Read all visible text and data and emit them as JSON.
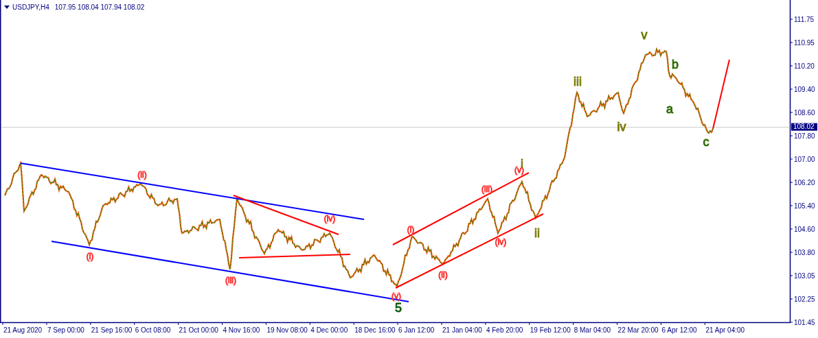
{
  "header": {
    "symbol": "USDJPY,H4",
    "quote": "107.95 108.04 107.94 108.02"
  },
  "price_axis": {
    "labels": [
      "111.75",
      "110.95",
      "110.20",
      "109.40",
      "108.60",
      "107.80",
      "107.00",
      "106.20",
      "105.40",
      "104.60",
      "103.80",
      "103.05",
      "102.25",
      "101.45"
    ],
    "current_price": "108.02"
  },
  "time_axis": {
    "labels": [
      "21 Aug 2020",
      "7 Sep 00:00",
      "21 Sep 16:00",
      "6 Oct 08:00",
      "21 Oct 00:00",
      "4 Nov 16:00",
      "19 Nov 08:00",
      "4 Dec 00:00",
      "18 Dec 16:00",
      "6 Jan 12:00",
      "21 Jan 04:00",
      "4 Feb 20:00",
      "19 Feb 12:00",
      "8 Mar 04:00",
      "22 Mar 20:00",
      "6 Apr 12:00",
      "21 Apr 04:00"
    ]
  },
  "wave_labels": [
    {
      "text": "(i)",
      "kind": "minor",
      "color": "#ff3030"
    },
    {
      "text": "(ii)",
      "kind": "minor",
      "color": "#ff3030"
    },
    {
      "text": "(iii)",
      "kind": "minor",
      "color": "#ff3030"
    },
    {
      "text": "(iv)",
      "kind": "minor",
      "color": "#ff3030"
    },
    {
      "text": "(v)",
      "kind": "minor",
      "color": "#ff3030"
    },
    {
      "text": "5",
      "kind": "major",
      "color": "#0a5a0a"
    },
    {
      "text": "(i)",
      "kind": "minor",
      "color": "#ff3030"
    },
    {
      "text": "(ii)",
      "kind": "minor",
      "color": "#ff3030"
    },
    {
      "text": "(iii)",
      "kind": "minor",
      "color": "#ff3030"
    },
    {
      "text": "(iv)",
      "kind": "minor",
      "color": "#ff3030"
    },
    {
      "text": "(v)",
      "kind": "minor",
      "color": "#ff3030"
    },
    {
      "text": "i",
      "kind": "major",
      "color": "#7a7a00"
    },
    {
      "text": "ii",
      "kind": "major",
      "color": "#7a7a00"
    },
    {
      "text": "iii",
      "kind": "major",
      "color": "#7a7a00"
    },
    {
      "text": "iv",
      "kind": "major",
      "color": "#7a7a00"
    },
    {
      "text": "v",
      "kind": "major",
      "color": "#6a7a00"
    },
    {
      "text": "b",
      "kind": "major",
      "color": "#2f6a00"
    },
    {
      "text": "a",
      "kind": "major",
      "color": "#2f6a00"
    },
    {
      "text": "c",
      "kind": "major",
      "color": "#2f6a00"
    }
  ]
}
